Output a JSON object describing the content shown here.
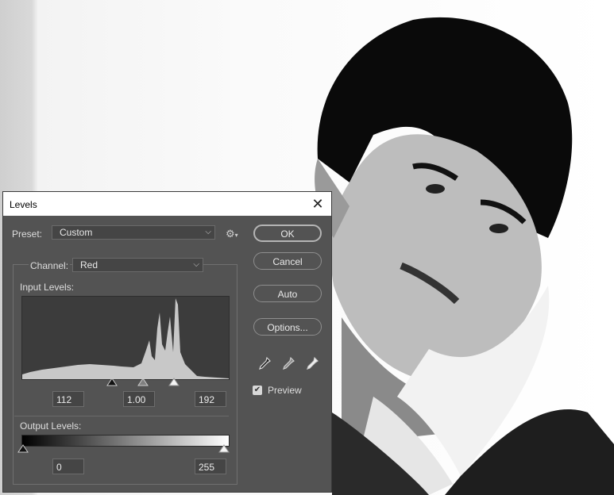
{
  "dialog": {
    "title": "Levels",
    "close_glyph": "✕",
    "preset_label": "Preset:",
    "preset_value": "Custom",
    "channel_label": "Channel:",
    "channel_value": "Red",
    "input_levels_label": "Input Levels:",
    "output_levels_label": "Output Levels:",
    "input_black": "112",
    "input_gamma": "1.00",
    "input_white": "192",
    "output_black": "0",
    "output_white": "255",
    "preview_label": "Preview",
    "preview_checked": true
  },
  "buttons": {
    "ok": "OK",
    "cancel": "Cancel",
    "auto": "Auto",
    "options": "Options..."
  },
  "icons": {
    "close": "close-icon",
    "gear": "gear-icon",
    "dropdown": "chevron-down-icon",
    "black_eyedropper": "black-point-eyedropper-icon",
    "gray_eyedropper": "gray-point-eyedropper-icon",
    "white_eyedropper": "white-point-eyedropper-icon",
    "check": "checkmark-icon"
  },
  "colors": {
    "dialog_bg": "#535353",
    "histogram_bg": "#3c3c3c",
    "histogram_fill": "#c8c8c8"
  }
}
